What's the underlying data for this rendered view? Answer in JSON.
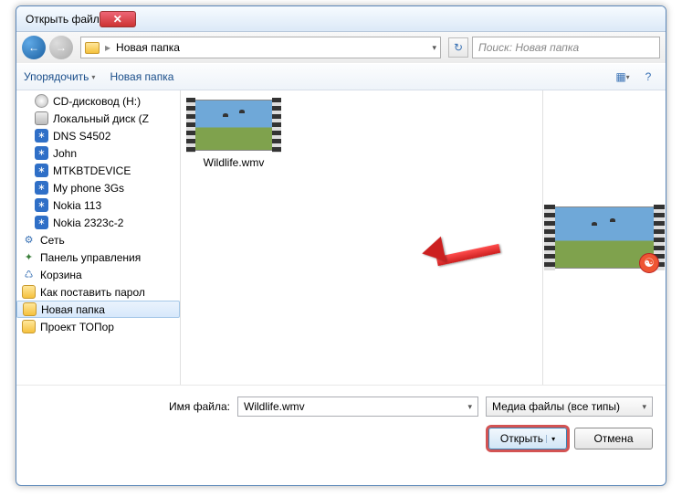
{
  "titlebar": {
    "title": "Открыть файл",
    "close_glyph": "✕"
  },
  "nav": {
    "back_glyph": "←",
    "fwd_glyph": "→",
    "breadcrumb_sep": "▸",
    "breadcrumb_current": "Новая папка",
    "dropdown_glyph": "▾",
    "refresh_glyph": "↻",
    "search_placeholder": "Поиск: Новая папка"
  },
  "toolbar": {
    "organize": "Упорядочить",
    "new_folder": "Новая папка",
    "view_glyph": "▦",
    "help_glyph": "?",
    "drop_glyph": "▾"
  },
  "tree": [
    {
      "label": "CD-дисковод (H:)",
      "icon": "disc",
      "lvl": 1
    },
    {
      "label": "Локальный диск (Z",
      "icon": "drive",
      "lvl": 1
    },
    {
      "label": "DNS S4502",
      "icon": "bt",
      "lvl": 1
    },
    {
      "label": "John",
      "icon": "bt",
      "lvl": 1
    },
    {
      "label": "MTKBTDEVICE",
      "icon": "bt",
      "lvl": 1
    },
    {
      "label": "My phone 3Gs",
      "icon": "bt",
      "lvl": 1
    },
    {
      "label": "Nokia 113",
      "icon": "bt",
      "lvl": 1
    },
    {
      "label": "Nokia 2323c-2",
      "icon": "bt",
      "lvl": 1
    },
    {
      "label": "Сеть",
      "icon": "net",
      "lvl": 0
    },
    {
      "label": "Панель управления",
      "icon": "cp",
      "lvl": 0
    },
    {
      "label": "Корзина",
      "icon": "bin",
      "lvl": 0
    },
    {
      "label": "Как поставить парол",
      "icon": "folder",
      "lvl": 0
    },
    {
      "label": "Новая папка",
      "icon": "folder",
      "lvl": 0,
      "selected": true
    },
    {
      "label": "Проект ТОПор",
      "icon": "folder",
      "lvl": 0
    }
  ],
  "bt_glyph": "∗",
  "files": [
    {
      "name": "Wildlife.wmv"
    }
  ],
  "footer": {
    "filename_label": "Имя файла:",
    "filename_value": "Wildlife.wmv",
    "type_filter": "Медиа файлы (все типы)",
    "open_label": "Открыть",
    "cancel_label": "Отмена",
    "split_glyph": "▾",
    "combo_glyph": "▾"
  },
  "preview_badge_glyph": "☯"
}
